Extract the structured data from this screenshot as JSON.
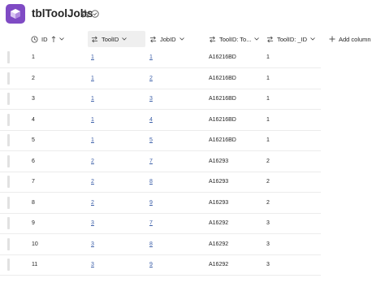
{
  "title": "tblToolJobs",
  "columns": {
    "id": "ID",
    "toolid": "ToolID",
    "jobid": "JobID",
    "tooltv": "ToolID: To...",
    "toolid2": "ToolID: _ID",
    "add": "Add column"
  },
  "rows": [
    {
      "id": "1",
      "tool": "1",
      "job": "1",
      "toolv": "A16216BD",
      "tid": "1"
    },
    {
      "id": "2",
      "tool": "1",
      "job": "2",
      "toolv": "A16216BD",
      "tid": "1"
    },
    {
      "id": "3",
      "tool": "1",
      "job": "3",
      "toolv": "A16216BD",
      "tid": "1"
    },
    {
      "id": "4",
      "tool": "1",
      "job": "4",
      "toolv": "A16216BD",
      "tid": "1"
    },
    {
      "id": "5",
      "tool": "1",
      "job": "5",
      "toolv": "A16216BD",
      "tid": "1"
    },
    {
      "id": "6",
      "tool": "2",
      "job": "7",
      "toolv": "A16293",
      "tid": "2"
    },
    {
      "id": "7",
      "tool": "2",
      "job": "8",
      "toolv": "A16293",
      "tid": "2"
    },
    {
      "id": "8",
      "tool": "2",
      "job": "9",
      "toolv": "A16293",
      "tid": "2"
    },
    {
      "id": "9",
      "tool": "3",
      "job": "7",
      "toolv": "A16292",
      "tid": "3"
    },
    {
      "id": "10",
      "tool": "3",
      "job": "8",
      "toolv": "A16292",
      "tid": "3"
    },
    {
      "id": "11",
      "tool": "3",
      "job": "9",
      "toolv": "A16292",
      "tid": "3"
    }
  ],
  "colors": {
    "accent": "#7f4bc4",
    "link": "#3c5fa8"
  }
}
